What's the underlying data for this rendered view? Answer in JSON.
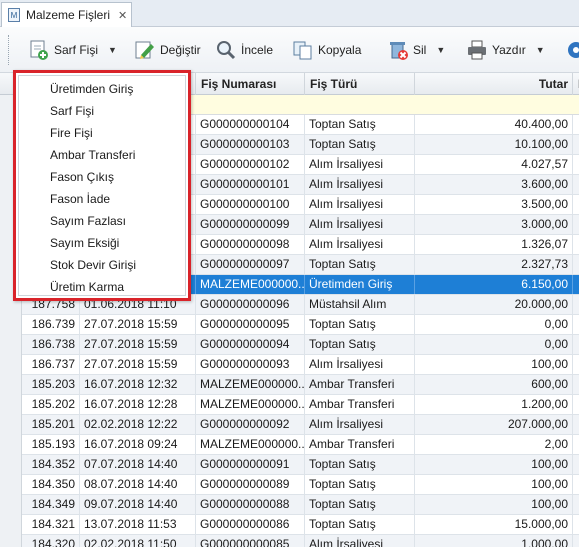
{
  "tab": {
    "title": "Malzeme Fişleri",
    "close": "✕",
    "icon": "M"
  },
  "toolbar": {
    "sarf": "Sarf Fişi",
    "degistir": "Değiştir",
    "incele": "İncele",
    "kopyala": "Kopyala",
    "sil": "Sil",
    "yazdir": "Yazdır"
  },
  "columns": {
    "fis_no": "Fiş Numarası",
    "fis_turu": "Fiş Türü",
    "tutar": "Tutar",
    "extra": "F"
  },
  "menu": [
    "Üretimden Giriş",
    "Sarf Fişi",
    "Fire Fişi",
    "Ambar Transferi",
    "Fason Çıkış",
    "Fason İade",
    "Sayım Fazlası",
    "Sayım Eksiği",
    "Stok Devir Girişi",
    "Üretim Karma"
  ],
  "rows": [
    {
      "ref": "",
      "date": "",
      "no": "G000000000104",
      "type": "Toptan Satış",
      "amount": "40.400,00"
    },
    {
      "ref": "",
      "date": "",
      "no": "G000000000103",
      "type": "Toptan Satış",
      "amount": "10.100,00"
    },
    {
      "ref": "",
      "date": "",
      "no": "G000000000102",
      "type": "Alım İrsaliyesi",
      "amount": "4.027,57"
    },
    {
      "ref": "",
      "date": "",
      "no": "G000000000101",
      "type": "Alım İrsaliyesi",
      "amount": "3.600,00"
    },
    {
      "ref": "",
      "date": "",
      "no": "G000000000100",
      "type": "Alım İrsaliyesi",
      "amount": "3.500,00"
    },
    {
      "ref": "",
      "date": "",
      "no": "G000000000099",
      "type": "Alım İrsaliyesi",
      "amount": "3.000,00"
    },
    {
      "ref": "",
      "date": "",
      "no": "G000000000098",
      "type": "Alım İrsaliyesi",
      "amount": "1.326,07"
    },
    {
      "ref": "",
      "date": "",
      "no": "G000000000097",
      "type": "Toptan Satış",
      "amount": "2.327,73"
    },
    {
      "ref": "",
      "date": "",
      "no": "MALZEME000000...",
      "type": "Üretimden Giriş",
      "amount": "6.150,00"
    },
    {
      "ref": "187.758",
      "date": "01.06.2018 11:10",
      "no": "G000000000096",
      "type": "Müstahsil Alım",
      "amount": "20.000,00"
    },
    {
      "ref": "186.739",
      "date": "27.07.2018 15:59",
      "no": "G000000000095",
      "type": "Toptan Satış",
      "amount": "0,00"
    },
    {
      "ref": "186.738",
      "date": "27.07.2018 15:59",
      "no": "G000000000094",
      "type": "Toptan Satış",
      "amount": "0,00"
    },
    {
      "ref": "186.737",
      "date": "27.07.2018 15:59",
      "no": "G000000000093",
      "type": "Alım İrsaliyesi",
      "amount": "100,00"
    },
    {
      "ref": "185.203",
      "date": "16.07.2018 12:32",
      "no": "MALZEME000000...",
      "type": "Ambar Transferi",
      "amount": "600,00"
    },
    {
      "ref": "185.202",
      "date": "16.07.2018 12:28",
      "no": "MALZEME000000...",
      "type": "Ambar Transferi",
      "amount": "1.200,00"
    },
    {
      "ref": "185.201",
      "date": "02.02.2018 12:22",
      "no": "G000000000092",
      "type": "Alım İrsaliyesi",
      "amount": "207.000,00"
    },
    {
      "ref": "185.193",
      "date": "16.07.2018 09:24",
      "no": "MALZEME000000...",
      "type": "Ambar Transferi",
      "amount": "2,00"
    },
    {
      "ref": "184.352",
      "date": "07.07.2018 14:40",
      "no": "G000000000091",
      "type": "Toptan Satış",
      "amount": "100,00"
    },
    {
      "ref": "184.350",
      "date": "08.07.2018 14:40",
      "no": "G000000000089",
      "type": "Toptan Satış",
      "amount": "100,00"
    },
    {
      "ref": "184.349",
      "date": "09.07.2018 14:40",
      "no": "G000000000088",
      "type": "Toptan Satış",
      "amount": "100,00"
    },
    {
      "ref": "184.321",
      "date": "13.07.2018 11:53",
      "no": "G000000000086",
      "type": "Toptan Satış",
      "amount": "15.000,00"
    },
    {
      "ref": "184.320",
      "date": "02.02.2018 11:50",
      "no": "G000000000085",
      "type": "Alım İrsaliyesi",
      "amount": "1.000,00"
    }
  ],
  "selected_row_index": 8,
  "colors": {
    "accent": "#1e7fd6",
    "highlight_border": "#d9232a",
    "filter_row": "#fffde0"
  },
  "icons": [
    "sarf-fisi-icon",
    "degistir-icon",
    "incele-icon",
    "kopyala-icon",
    "sil-icon",
    "yazdir-icon",
    "settings-icon"
  ]
}
